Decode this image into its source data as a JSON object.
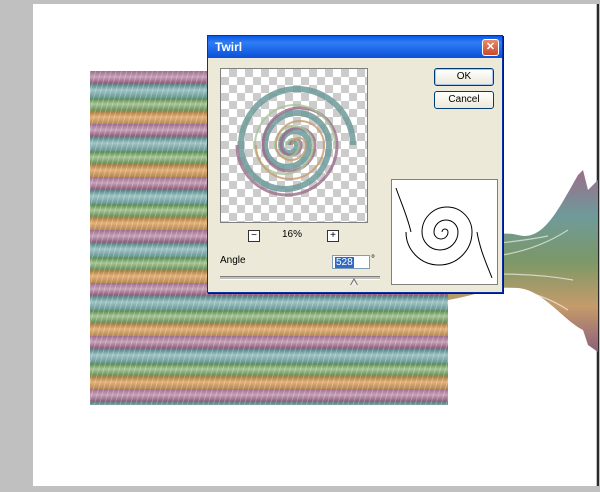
{
  "dialog": {
    "title": "Twirl",
    "close_glyph": "✕",
    "ok_label": "OK",
    "cancel_label": "Cancel",
    "zoom": {
      "minus": "−",
      "plus": "+",
      "level": "16%"
    },
    "angle": {
      "label": "Angle",
      "value": "528",
      "unit": "°",
      "slider_fraction": 0.84
    }
  },
  "icons": {
    "close": "close-icon",
    "zoom_out": "zoom-out-icon",
    "zoom_in": "zoom-in-icon",
    "spiral": "twirl-spiral-icon"
  },
  "colors": {
    "titlebar": "#0a59e6",
    "close_button": "#c74a2e",
    "selection": "#316ac5",
    "dialog_bg": "#ece9d8"
  }
}
